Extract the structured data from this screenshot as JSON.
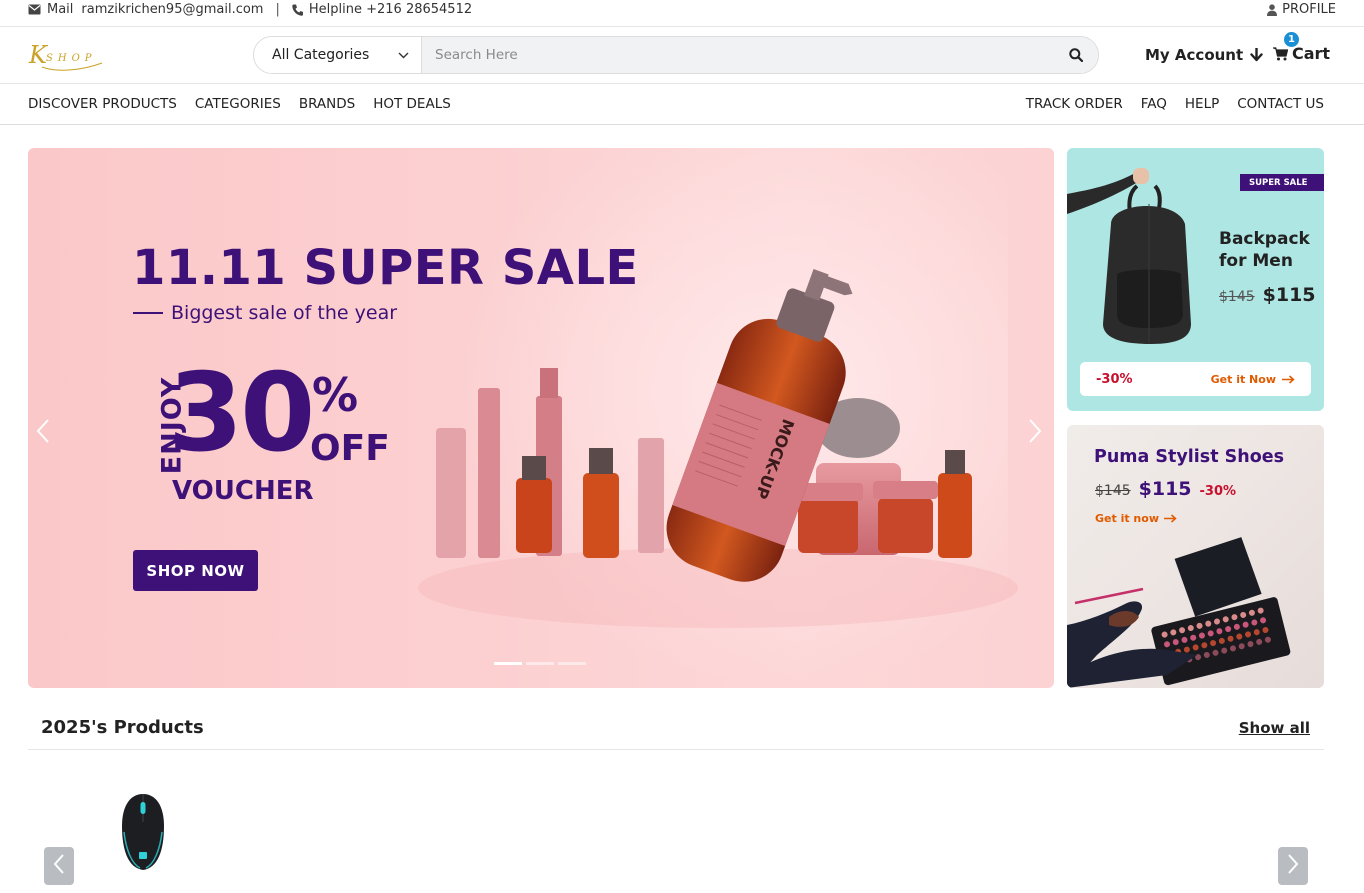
{
  "topbar": {
    "mail_label": "Mail",
    "mail_address": "ramzikrichen95@gmail.com",
    "separator": "|",
    "helpline": "Helpline +216 28654512",
    "profile": "PROFILE"
  },
  "header": {
    "logo_text": "K S H O P",
    "category_select": "All Categories",
    "search_placeholder": "Search Here",
    "my_account": "My Account",
    "cart_label": "Cart",
    "cart_count": "1"
  },
  "nav": {
    "left": [
      "DISCOVER PRODUCTS",
      "CATEGORIES",
      "BRANDS",
      "HOT DEALS"
    ],
    "right": [
      "TRACK ORDER",
      "FAQ",
      "HELP",
      "CONTACT US"
    ]
  },
  "hero": {
    "headline": "11.11 SUPER SALE",
    "subheadline": "Biggest sale of the year",
    "enjoy": "ENJOY",
    "amount": "30",
    "percent": "%",
    "off": "OFF",
    "voucher": "VOUCHER",
    "cta": "SHOP NOW",
    "bottle_text": "MOCK-UP",
    "active_slide": 1,
    "slide_count": 3
  },
  "promo_backpack": {
    "tag": "SUPER SALE",
    "title_line1": "Backpack",
    "title_line2": "for Men",
    "old_price": "$145",
    "new_price": "$115",
    "discount": "-30%",
    "cta": "Get it Now"
  },
  "promo_shoes": {
    "title": "Puma Stylist Shoes",
    "old_price": "$145",
    "new_price": "$115",
    "discount": "-30%",
    "cta": "Get it now"
  },
  "products": {
    "title": "2025's Products",
    "show_all": "Show all"
  },
  "colors": {
    "brand_purple": "#3d1178",
    "accent_orange": "#e05a00",
    "discount_red": "#c8102e",
    "cart_badge": "#1a8fd6"
  }
}
